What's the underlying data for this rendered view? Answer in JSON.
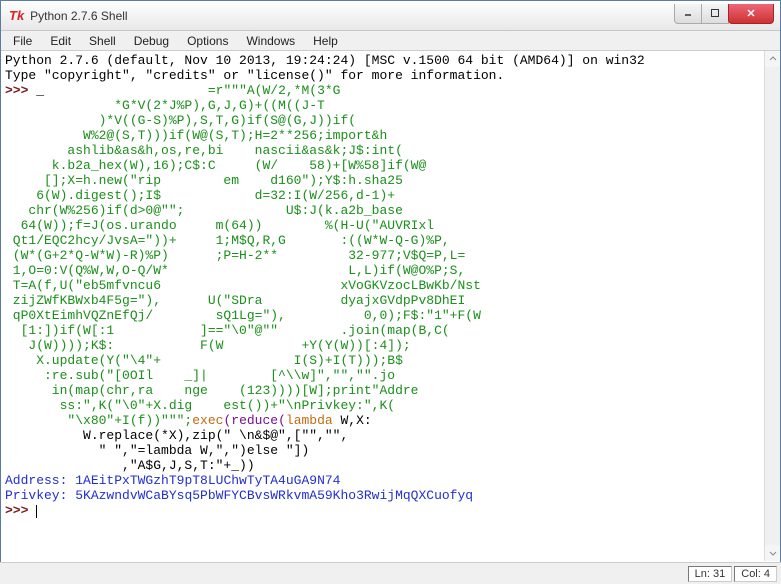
{
  "window": {
    "title": "Python 2.7.6 Shell"
  },
  "menubar": {
    "items": [
      "File",
      "Edit",
      "Shell",
      "Debug",
      "Options",
      "Windows",
      "Help"
    ]
  },
  "shell": {
    "banner1": "Python 2.7.6 (default, Nov 10 2013, 19:24:24) [MSC v.1500 64 bit (AMD64)] on win32",
    "banner2": "Type \"copyright\", \"credits\" or \"license()\" for more information.",
    "prompt": ">>> ",
    "underscore": "_",
    "code_lines": [
      "                     =r\"\"\"A(W/2,*M(3*G",
      "              *G*V(2*J%P),G,J,G)+((M((J-T",
      "            )*V((G-S)%P),S,T,G)if(S@(G,J))if(",
      "          W%2@(S,T)))if(W@(S,T);H=2**256;import&h",
      "        ashlib&as&h,os,re,bi    nascii&as&k;J$:int(",
      "      k.b2a_hex(W),16);C$:C     (W/    58)+[W%58]if(W@",
      "     [];X=h.new(\"rip        em    d160\");Y$:h.sha25",
      "    6(W).digest();I$            d=32:I(W/256,d-1)+",
      "   chr(W%256)if(d>0@\"\";             U$:J(k.a2b_base",
      "  64(W));f=J(os.urando     m(64))        %(H-U(\"AUVRIxl",
      " Qt1/EQC2hcy/JvsA=\"))+     1;M$Q,R,G       :((W*W-Q-G)%P,",
      " (W*(G+2*Q-W*W)-R)%P)      ;P=H-2**         32-977;V$Q=P,L=",
      " 1,O=0:V(Q%W,W,O-Q/W*                       L,L)if(W@O%P;S,",
      " T=A(f,U(\"eb5mfvncu6                       xVoGKVzocLBwKb/Nst",
      " zijZWfKBWxb4F5g=\"),      U(\"SDra          dyajxGVdpPv8DhEI",
      " qP0XtEimhVQZnEfQj/        sQ1Lg=\"),          0,0);F$:\"1\"+F(W",
      "  [1:])if(W[:1           ]==\"\\0\"@\"\"        .join(map(B,C(",
      "   J(W))));K$:           F(W          +Y(Y(W))[:4]);",
      "    X.update(Y(\"\\4\"+                 I(S)+I(T)));B$",
      "     :re.sub(\"[0OIl    _]|        [^\\\\w]\",\"\",\"\".jo",
      "      in(map(chr,ra    nge    (123))))[W];print\"Addre",
      "       ss:\",K(\"\\0\"+X.dig    est())+\"\\nPrivkey:\",K("
    ],
    "exec_line_prefix": "        \"\\x80\"+I(f))\"\"\";",
    "exec_kw": "exec",
    "reduce_kw": "reduce",
    "lambda_kw": "lambda",
    "exec_line_tail": " W,X:",
    "tail_lines": [
      "          W.replace(*X),zip(\" \\n&$@\",[\"\",\"\",",
      "            \" \",\"=lambda W,\",\")else \"])",
      "               ,\"A$G,J,S,T:\"+_))"
    ],
    "out1_label": "Address:",
    "out1_val": " 1AEitPxTWGzhT9pT8LUChwTyTA4uGA9N74",
    "out2_label": "Privkey:",
    "out2_val": " 5KAzwndvWCaBYsq5PbWFYCBvsWRkvmA59Kho3RwijMqQXCuofyq"
  },
  "statusbar": {
    "ln": "Ln: 31",
    "col": "Col: 4"
  }
}
